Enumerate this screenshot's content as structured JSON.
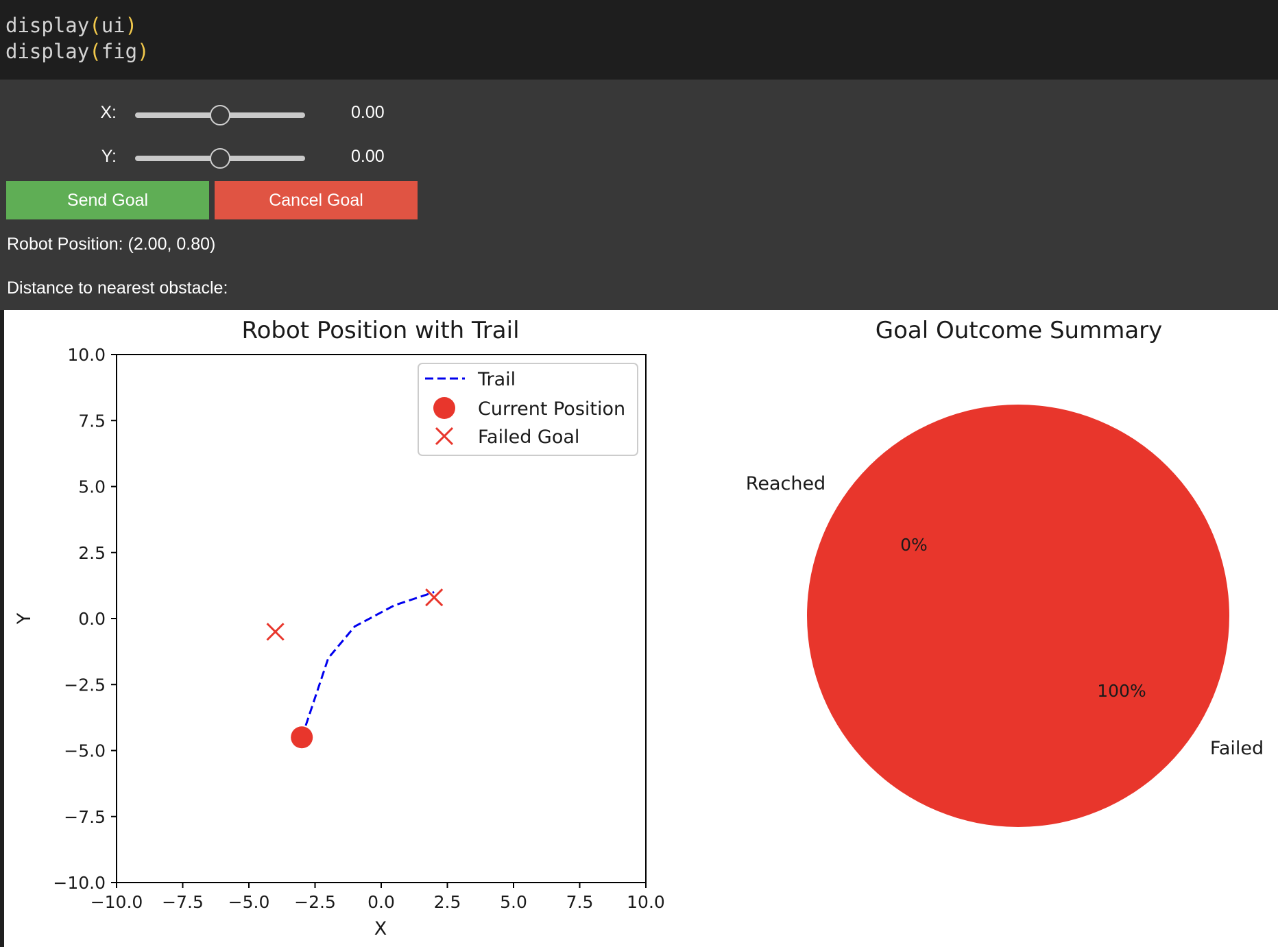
{
  "code": {
    "lines": [
      {
        "fn": "display",
        "open": "(",
        "arg": "ui",
        "close": ")"
      },
      {
        "fn": "display",
        "open": "(",
        "arg": "fig",
        "close": ")"
      }
    ]
  },
  "controls": {
    "x_slider": {
      "label": "X:",
      "value_text": "0.00",
      "min": -10,
      "max": 10,
      "value": 0
    },
    "y_slider": {
      "label": "Y:",
      "value_text": "0.00",
      "min": -10,
      "max": 10,
      "value": 0
    },
    "send_goal_label": "Send Goal",
    "cancel_goal_label": "Cancel Goal",
    "robot_position_text": "Robot Position: (2.00, 0.80)",
    "distance_text": "Distance to nearest obstacle:"
  },
  "colors": {
    "send_button": "#5fae55",
    "cancel_button": "#e05443",
    "trail": "#0000ee",
    "marker": "#e8362c",
    "pie_failed": "#e8362c",
    "pie_reached": "#5fae55"
  },
  "chart_data": [
    {
      "type": "line",
      "title": "Robot Position with Trail",
      "xlabel": "X",
      "ylabel": "Y",
      "xlim": [
        -10,
        10
      ],
      "ylim": [
        -10,
        10
      ],
      "xticks": [
        -10,
        -7.5,
        -5,
        -2.5,
        0,
        2.5,
        5,
        7.5,
        10
      ],
      "yticks": [
        -10,
        -7.5,
        -5,
        -2.5,
        0,
        2.5,
        5,
        7.5,
        10
      ],
      "xtick_labels": [
        "−10.0",
        "−7.5",
        "−5.0",
        "−2.5",
        "0.0",
        "2.5",
        "5.0",
        "7.5",
        "10.0"
      ],
      "ytick_labels": [
        "−10.0",
        "−7.5",
        "−5.0",
        "−2.5",
        "0.0",
        "2.5",
        "5.0",
        "7.5",
        "10.0"
      ],
      "grid": false,
      "legend": "top-right",
      "series": [
        {
          "name": "Trail",
          "style": "dashed",
          "x": [
            -3.0,
            -2.0,
            -1.0,
            0.5,
            2.0
          ],
          "y": [
            -4.5,
            -1.5,
            -0.3,
            0.5,
            1.0
          ]
        },
        {
          "name": "Current Position",
          "style": "marker-circle",
          "x": [
            -3.0
          ],
          "y": [
            -4.5
          ]
        },
        {
          "name": "Failed Goal",
          "style": "marker-x",
          "x": [
            -4.0,
            2.0
          ],
          "y": [
            -0.5,
            0.8
          ]
        }
      ]
    },
    {
      "type": "pie",
      "title": "Goal Outcome Summary",
      "labels": [
        "Reached",
        "Failed"
      ],
      "values": [
        0,
        100
      ],
      "pct_labels": [
        "0%",
        "100%"
      ],
      "startangle": 90
    }
  ]
}
